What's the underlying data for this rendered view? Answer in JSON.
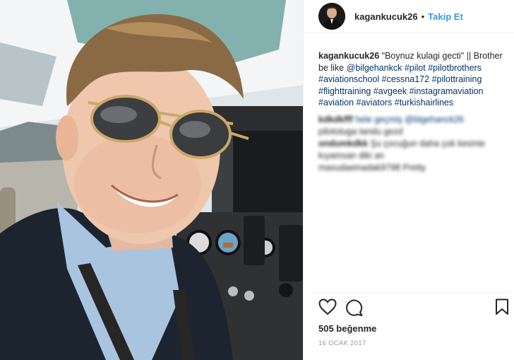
{
  "post": {
    "photo_alt": "selfie in aircraft cockpit",
    "header": {
      "username": "kagankucuk26",
      "separator": "•",
      "follow_label": "Takip Et"
    },
    "caption": {
      "username": "kagankucuk26",
      "text": "\"Boynuz kulagi gecti\" || Brother be like",
      "mention": "@bilgehankck",
      "hashtags": [
        "#pilot",
        "#pilotbrothers",
        "#aviationschool",
        "#cessna172",
        "#pilottraining",
        "#flighttraining",
        "#avgeek",
        "#instagramaviation",
        "#aviation",
        "#aviators",
        "#turkishairlines"
      ]
    },
    "blurred_comments": [
      {
        "user": "kdkdkfff",
        "text": "hele geçmiş @blgehanck26"
      },
      {
        "user": "",
        "text": "pilototuga tandu gezd"
      },
      {
        "user": "ondumkdkk",
        "text": "Şu çocuğun daha çok kesinie kıyamsan diki an"
      },
      {
        "user": "",
        "text": "maxudaeinadak9798 Pretty"
      }
    ],
    "icons": {
      "like": "heart-icon",
      "comment": "comment-icon",
      "save": "bookmark-icon"
    },
    "likes_text": "505 beğenme",
    "date_text": "16 OCAK 2017"
  }
}
